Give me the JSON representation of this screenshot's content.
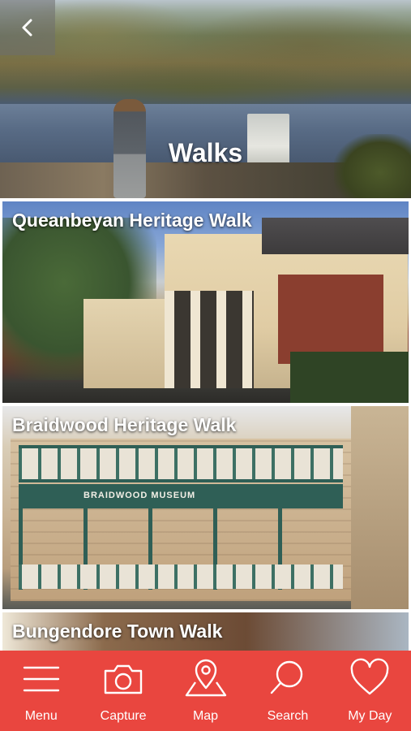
{
  "header": {
    "title": "Walks",
    "back_icon": "chevron-left-icon"
  },
  "walks": [
    {
      "title": "Queanbeyan Heritage Walk"
    },
    {
      "title": "Braidwood Heritage Walk",
      "sign_text": "BRAIDWOOD  MUSEUM"
    },
    {
      "title": "Bungendore Town Walk"
    }
  ],
  "tabbar": {
    "background": "#e9463f",
    "items": [
      {
        "label": "Menu",
        "icon": "menu-icon"
      },
      {
        "label": "Capture",
        "icon": "camera-icon"
      },
      {
        "label": "Map",
        "icon": "map-pin-icon"
      },
      {
        "label": "Search",
        "icon": "search-icon"
      },
      {
        "label": "My Day",
        "icon": "heart-icon"
      }
    ]
  }
}
